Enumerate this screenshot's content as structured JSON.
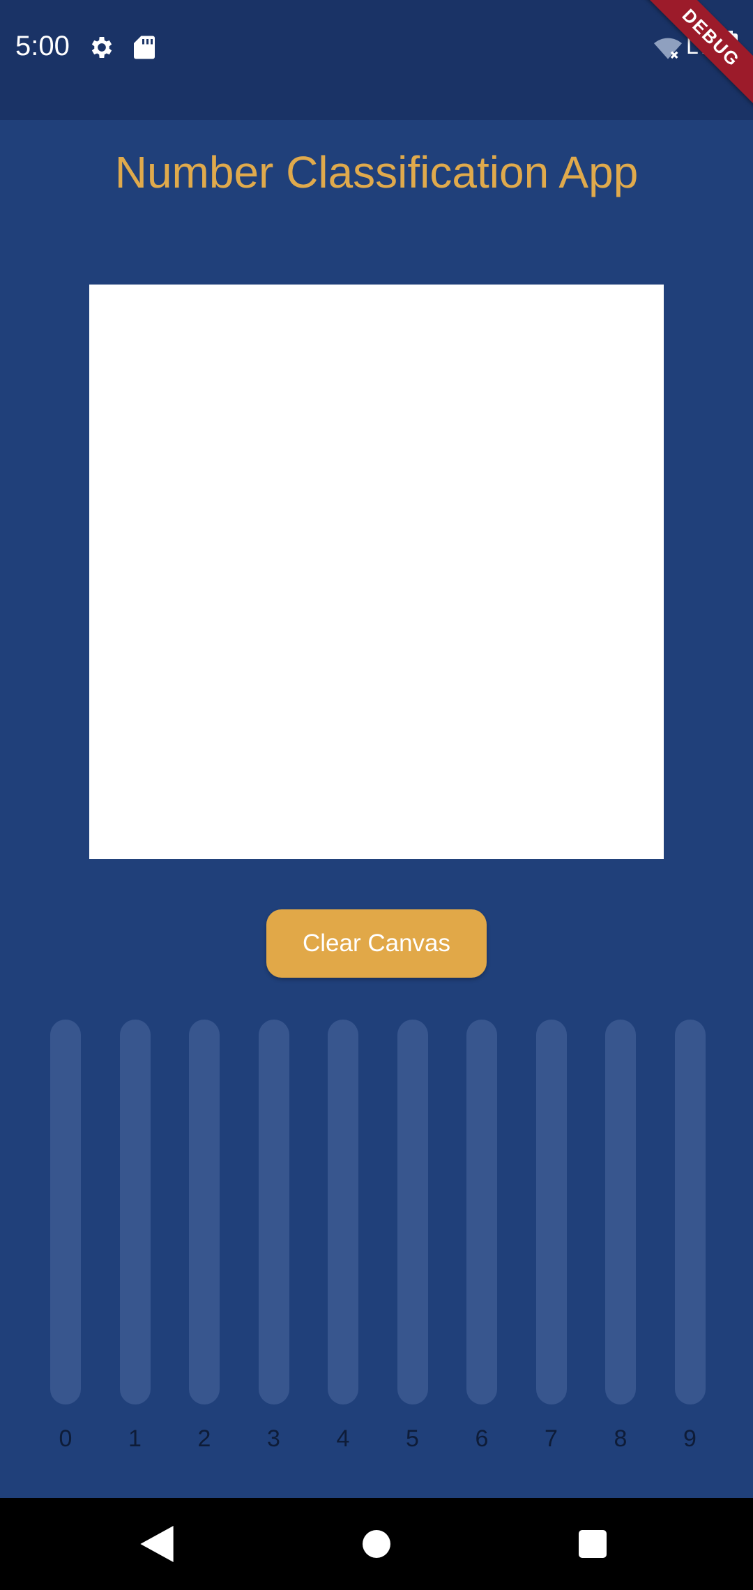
{
  "status_bar": {
    "time": "5:00",
    "network": "LTE",
    "debug_banner": "DEBUG",
    "icons": [
      "gear-icon",
      "sd-card-icon",
      "wifi-off-icon",
      "battery-icon"
    ]
  },
  "app": {
    "title": "Number Classification App"
  },
  "actions": {
    "clear_label": "Clear Canvas"
  },
  "predictions": {
    "digits": [
      "0",
      "1",
      "2",
      "3",
      "4",
      "5",
      "6",
      "7",
      "8",
      "9"
    ],
    "probabilities": [
      0,
      0,
      0,
      0,
      0,
      0,
      0,
      0,
      0,
      0
    ]
  },
  "navigation": {
    "icons": [
      "back-icon",
      "home-icon",
      "recents-icon"
    ]
  },
  "colors": {
    "background": "#20407a",
    "accent": "#e1a848",
    "title": "#e0aa4c",
    "bar_track": "#38568e"
  }
}
